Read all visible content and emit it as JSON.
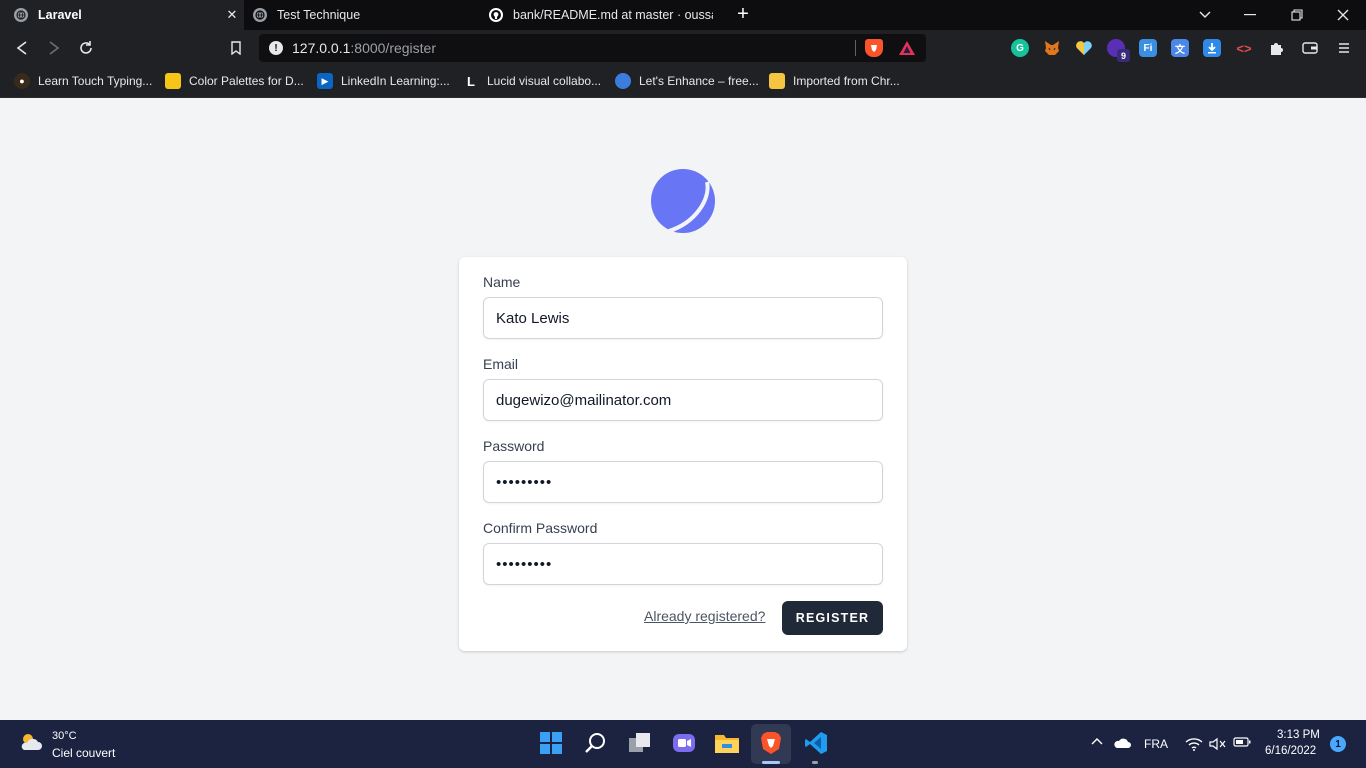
{
  "browser": {
    "tabs": [
      {
        "label": "Laravel",
        "active": true
      },
      {
        "label": "Test Technique",
        "active": false
      },
      {
        "label": "bank/README.md at master · oussam",
        "active": false
      }
    ],
    "new_tab": "+",
    "url": {
      "host": "127.0.0.1",
      "path": ":8000/register"
    },
    "extensions": [
      "grammarly-icon",
      "metamask-icon",
      "heart-icon",
      "extension-badge-icon",
      "fi-icon",
      "translate-icon",
      "download-icon",
      "dev-tools-icon",
      "puzzle-icon",
      "wallet-icon"
    ],
    "extension_badge": "9",
    "bookmarks": [
      {
        "label": "Learn Touch Typing...",
        "icon": "ninja-icon"
      },
      {
        "label": "Color Palettes for D...",
        "icon": "palette-icon"
      },
      {
        "label": "LinkedIn Learning:...",
        "icon": "linkedin-learning-icon"
      },
      {
        "label": "Lucid visual collabo...",
        "icon": "lucid-icon"
      },
      {
        "label": "Let's Enhance – free...",
        "icon": "enhance-icon"
      },
      {
        "label": "Imported from Chr...",
        "icon": "folder-icon"
      }
    ]
  },
  "form": {
    "name": {
      "label": "Name",
      "value": "Kato Lewis"
    },
    "email": {
      "label": "Email",
      "value": "dugewizo@mailinator.com"
    },
    "password": {
      "label": "Password",
      "value": "•••••••••"
    },
    "confirm_password": {
      "label": "Confirm Password",
      "value": "•••••••••"
    },
    "already_registered": "Already registered?",
    "register_button": "REGISTER"
  },
  "colors": {
    "logo": "#6875f5",
    "button": "#1f2937",
    "page_bg": "#f3f4f6"
  },
  "taskbar": {
    "weather": {
      "temp": "30°C",
      "desc": "Ciel couvert"
    },
    "language": "FRA",
    "time": "3:13 PM",
    "date": "6/16/2022",
    "notifications": "1"
  }
}
